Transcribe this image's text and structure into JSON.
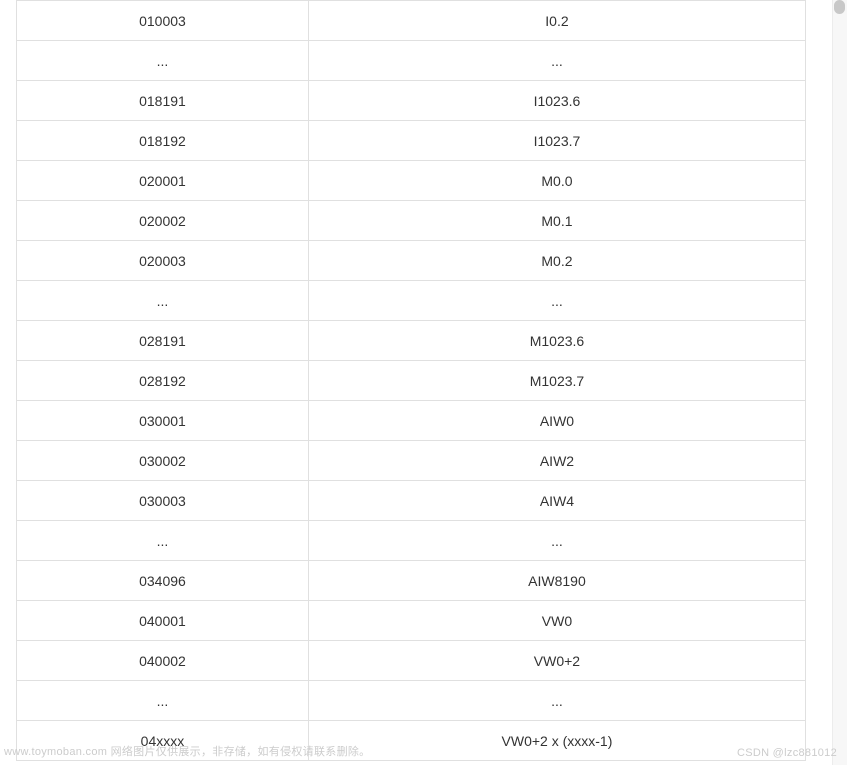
{
  "table": {
    "rows": [
      {
        "col1": "010003",
        "col2": "I0.2"
      },
      {
        "col1": "...",
        "col2": "..."
      },
      {
        "col1": "018191",
        "col2": "I1023.6"
      },
      {
        "col1": "018192",
        "col2": "I1023.7"
      },
      {
        "col1": "020001",
        "col2": "M0.0"
      },
      {
        "col1": "020002",
        "col2": "M0.1"
      },
      {
        "col1": "020003",
        "col2": "M0.2"
      },
      {
        "col1": "...",
        "col2": "..."
      },
      {
        "col1": "028191",
        "col2": "M1023.6"
      },
      {
        "col1": "028192",
        "col2": "M1023.7"
      },
      {
        "col1": "030001",
        "col2": "AIW0"
      },
      {
        "col1": "030002",
        "col2": "AIW2"
      },
      {
        "col1": "030003",
        "col2": "AIW4"
      },
      {
        "col1": "...",
        "col2": "..."
      },
      {
        "col1": "034096",
        "col2": "AIW8190"
      },
      {
        "col1": "040001",
        "col2": "VW0"
      },
      {
        "col1": "040002",
        "col2": "VW0+2"
      },
      {
        "col1": "...",
        "col2": "..."
      },
      {
        "col1": "04xxxx",
        "col2": "VW0+2 x (xxxx-1)"
      }
    ]
  },
  "footer": {
    "left": "www.toymoban.com 网络图片仅供展示，非存储，如有侵权请联系删除。",
    "right": "CSDN @lzc881012"
  }
}
